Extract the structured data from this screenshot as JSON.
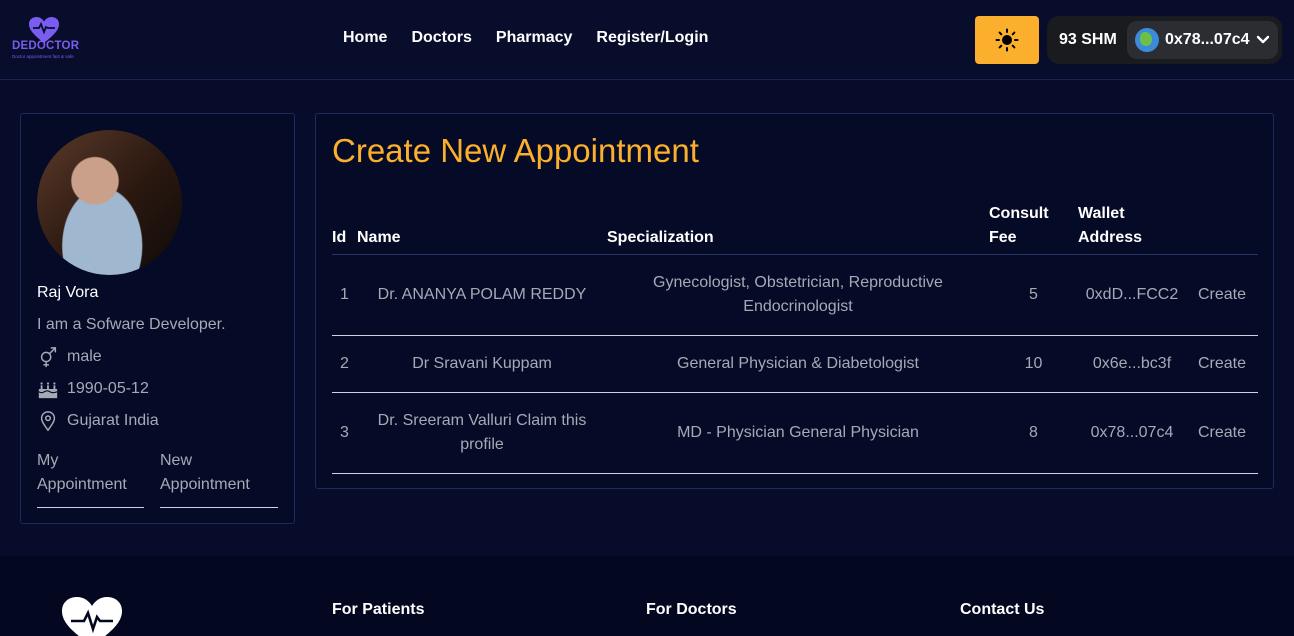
{
  "brand": {
    "name": "DEDOCTOR",
    "tagline": "Doctor appointment fast & safe",
    "color": "#7b5cf0"
  },
  "nav": [
    {
      "label": "Home"
    },
    {
      "label": "Doctors"
    },
    {
      "label": "Pharmacy"
    },
    {
      "label": "Register/Login"
    }
  ],
  "wallet": {
    "balance": "93 SHM",
    "address": "0x78...07c4"
  },
  "theme": {
    "icon": "sun-icon",
    "accent": "#fbaf2c"
  },
  "profile": {
    "name": "Raj Vora",
    "bio": "I am a Sofware Developer.",
    "gender": "male",
    "birthday": "1990-05-12",
    "location": "Gujarat India",
    "links": {
      "my_appointment": "My Appointment",
      "new_appointment": "New Appointment"
    }
  },
  "appointment": {
    "title": "Create New Appointment",
    "columns": {
      "id": "Id",
      "name": "Name",
      "specialization": "Specialization",
      "fee": "Consult Fee",
      "wallet": "Wallet Address"
    },
    "rows": [
      {
        "id": "1",
        "name": "Dr. ANANYA POLAM REDDY",
        "specialization": "Gynecologist, Obstetrician, Reproductive Endocrinologist",
        "fee": "5",
        "wallet": "0xdD...FCC2",
        "action": "Create"
      },
      {
        "id": "2",
        "name": "Dr Sravani Kuppam",
        "specialization": "General Physician & Diabetologist",
        "fee": "10",
        "wallet": "0x6e...bc3f",
        "action": "Create"
      },
      {
        "id": "3",
        "name": "Dr. Sreeram Valluri Claim this profile",
        "specialization": "MD - Physician General Physician",
        "fee": "8",
        "wallet": "0x78...07c4",
        "action": "Create"
      }
    ]
  },
  "footer": {
    "for_patients": "For Patients",
    "for_doctors": "For Doctors",
    "contact_us": "Contact Us"
  }
}
